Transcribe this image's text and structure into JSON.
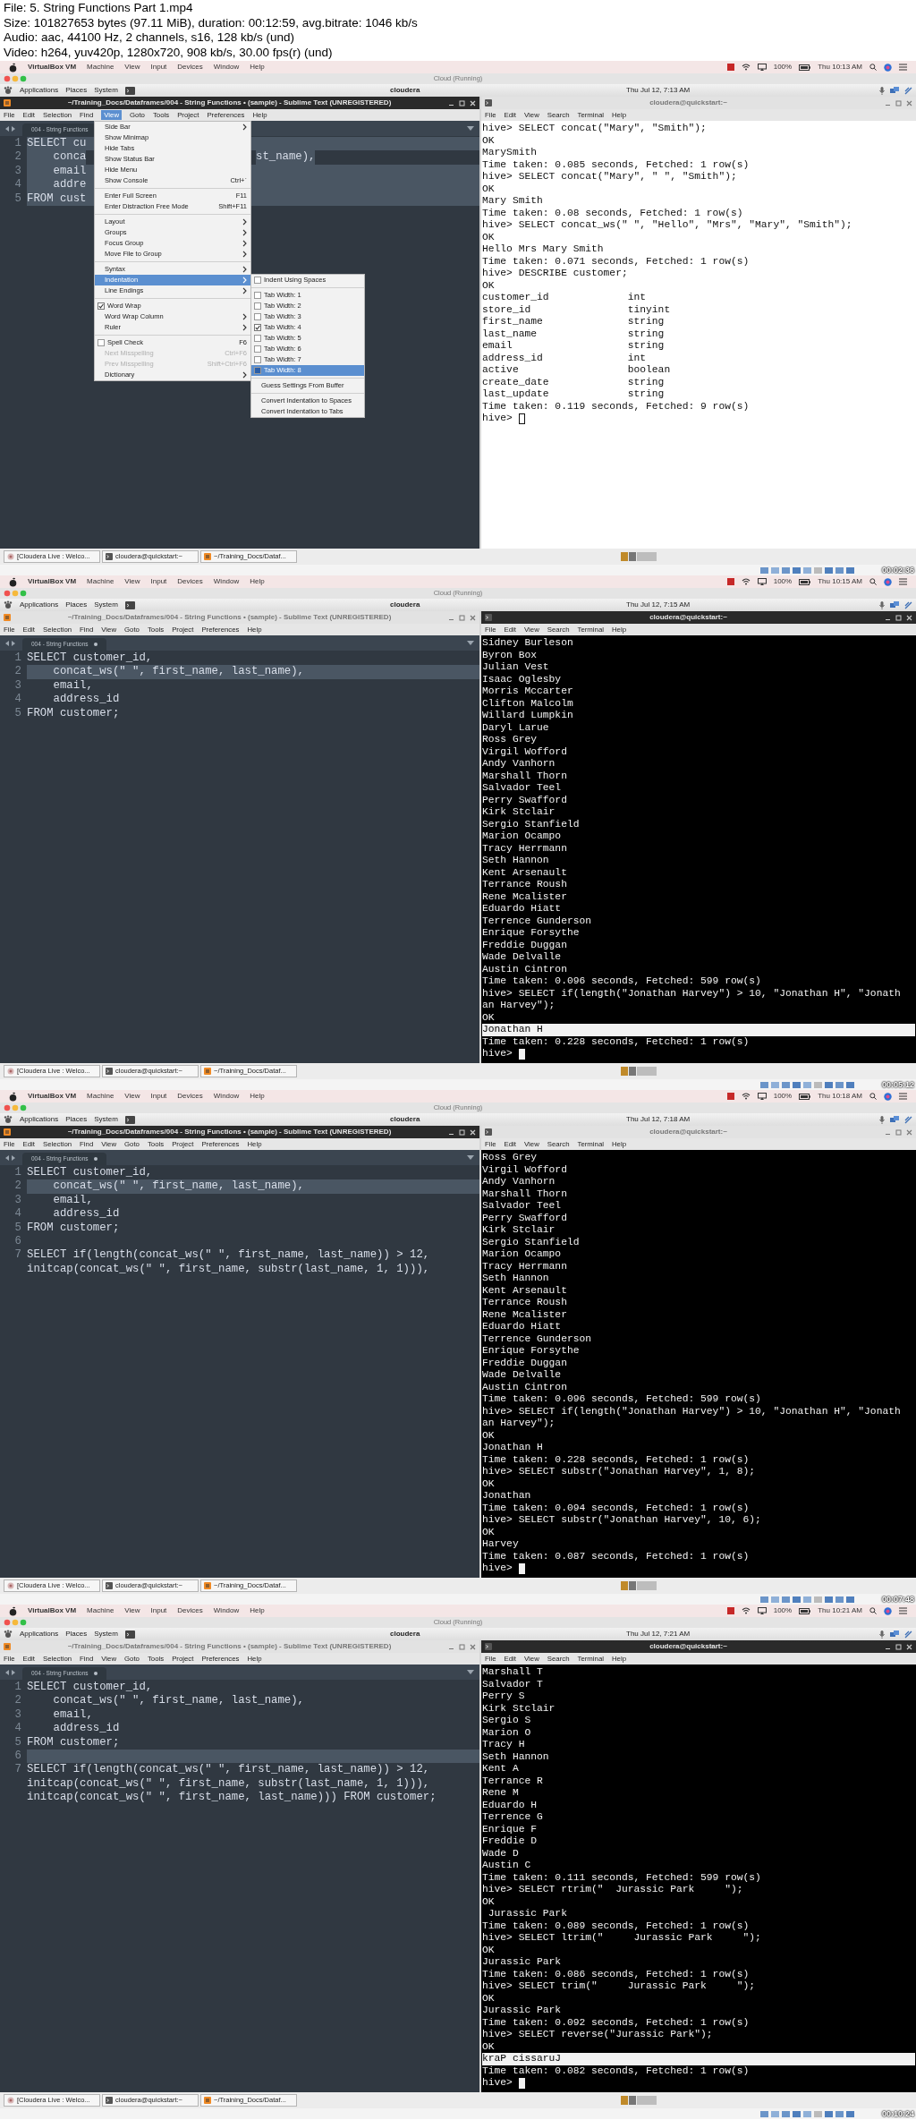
{
  "header": {
    "lines": [
      "File: 5. String Functions Part 1.mp4",
      "Size: 101827653 bytes (97.11 MiB), duration: 00:12:59, avg.bitrate: 1046 kb/s",
      "Audio: aac, 44100 Hz, 2 channels, s16, 128 kb/s (und)",
      "Video: h264, yuv420p, 1280x720, 908 kb/s, 30.00 fps(r) (und)"
    ]
  },
  "frames": [
    {
      "mac_menu": {
        "items": [
          "VirtualBox VM",
          "Machine",
          "View",
          "Input",
          "Devices",
          "Window",
          "Help"
        ],
        "battery": "100%",
        "clock": "Thu 10:13 AM"
      },
      "vm_window": {
        "title": "Cloud (Running)"
      },
      "guest_panel": {
        "menus": [
          "Applications",
          "Places",
          "System"
        ],
        "host": "cloudera",
        "clock": "Thu Jul 12, 7:13 AM"
      },
      "editor": {
        "title": "~/Training_Docs/Dataframes/004 - String Functions • (sample) - Sublime Text (UNREGISTERED)",
        "active": true,
        "menu": [
          {
            "label": "File",
            "selected": false
          },
          {
            "label": "Edit",
            "selected": false
          },
          {
            "label": "Selection",
            "selected": false
          },
          {
            "label": "Find",
            "selected": false
          },
          {
            "label": "View",
            "selected": true
          },
          {
            "label": "Goto",
            "selected": false
          },
          {
            "label": "Tools",
            "selected": false
          },
          {
            "label": "Project",
            "selected": false
          },
          {
            "label": "Preferences",
            "selected": false
          },
          {
            "label": "Help",
            "selected": false
          }
        ],
        "tab": "004 - String Functions",
        "lines": [
          {
            "num": "1",
            "text": "SELECT cu",
            "highlighted": true
          },
          {
            "num": "2",
            "text": "    conca",
            "tail": "st_name),",
            "highlighted": true
          },
          {
            "num": "3",
            "text": "    email",
            "highlighted": true
          },
          {
            "num": "4",
            "text": "    addre",
            "highlighted": true
          },
          {
            "num": "5",
            "text": "FROM cust",
            "highlighted": true
          }
        ],
        "popup": {
          "items": [
            {
              "kind": "submenu",
              "label": "Side Bar",
              "selected": false,
              "disabled": false
            },
            {
              "kind": "action",
              "label": "Show Minimap",
              "selected": false,
              "disabled": false
            },
            {
              "kind": "action",
              "label": "Hide Tabs",
              "selected": false,
              "disabled": false
            },
            {
              "kind": "action",
              "label": "Show Status Bar",
              "selected": false,
              "disabled": false
            },
            {
              "kind": "action",
              "label": "Hide Menu",
              "selected": false,
              "disabled": false
            },
            {
              "kind": "action",
              "label": "Show Console",
              "shortcut": "Ctrl+`",
              "selected": false,
              "disabled": false
            },
            {
              "kind": "separator"
            },
            {
              "kind": "action",
              "label": "Enter Full Screen",
              "shortcut": "F11",
              "selected": false,
              "disabled": false
            },
            {
              "kind": "action",
              "label": "Enter Distraction Free Mode",
              "shortcut": "Shift+F11",
              "selected": false,
              "disabled": false
            },
            {
              "kind": "separator"
            },
            {
              "kind": "submenu",
              "label": "Layout",
              "selected": false,
              "disabled": false
            },
            {
              "kind": "submenu",
              "label": "Groups",
              "selected": false,
              "disabled": false
            },
            {
              "kind": "submenu",
              "label": "Focus Group",
              "selected": false,
              "disabled": false
            },
            {
              "kind": "submenu",
              "label": "Move File to Group",
              "selected": false,
              "disabled": false
            },
            {
              "kind": "separator"
            },
            {
              "kind": "submenu",
              "label": "Syntax",
              "selected": false,
              "disabled": false
            },
            {
              "kind": "submenu",
              "label": "Indentation",
              "selected": true,
              "disabled": false,
              "items": [
                {
                  "kind": "check",
                  "label": "Indent Using Spaces",
                  "checked": false,
                  "selected": false,
                  "disabled": false
                },
                {
                  "kind": "separator"
                },
                {
                  "kind": "check",
                  "label": "Tab Width: 1",
                  "checked": false,
                  "selected": false,
                  "disabled": false
                },
                {
                  "kind": "check",
                  "label": "Tab Width: 2",
                  "checked": false,
                  "selected": false,
                  "disabled": false
                },
                {
                  "kind": "check",
                  "label": "Tab Width: 3",
                  "checked": false,
                  "selected": false,
                  "disabled": false
                },
                {
                  "kind": "check",
                  "label": "Tab Width: 4",
                  "checked": true,
                  "selected": false,
                  "disabled": false
                },
                {
                  "kind": "check",
                  "label": "Tab Width: 5",
                  "checked": false,
                  "selected": false,
                  "disabled": false
                },
                {
                  "kind": "check",
                  "label": "Tab Width: 6",
                  "checked": false,
                  "selected": false,
                  "disabled": false
                },
                {
                  "kind": "check",
                  "label": "Tab Width: 7",
                  "checked": false,
                  "selected": false,
                  "disabled": false
                },
                {
                  "kind": "check",
                  "label": "Tab Width: 8",
                  "checked": false,
                  "selected": true,
                  "disabled": false
                },
                {
                  "kind": "separator"
                },
                {
                  "kind": "action",
                  "label": "Guess Settings From Buffer",
                  "selected": false,
                  "disabled": false
                },
                {
                  "kind": "separator"
                },
                {
                  "kind": "action",
                  "label": "Convert Indentation to Spaces",
                  "selected": false,
                  "disabled": false
                },
                {
                  "kind": "action",
                  "label": "Convert Indentation to Tabs",
                  "selected": false,
                  "disabled": false
                }
              ]
            },
            {
              "kind": "submenu",
              "label": "Line Endings",
              "selected": false,
              "disabled": false
            },
            {
              "kind": "separator"
            },
            {
              "kind": "check",
              "label": "Word Wrap",
              "checked": true,
              "selected": false,
              "disabled": false
            },
            {
              "kind": "submenu",
              "label": "Word Wrap Column",
              "selected": false,
              "disabled": false
            },
            {
              "kind": "submenu",
              "label": "Ruler",
              "selected": false,
              "disabled": false
            },
            {
              "kind": "separator"
            },
            {
              "kind": "check",
              "label": "Spell Check",
              "shortcut": "F6",
              "checked": false,
              "selected": false,
              "disabled": false
            },
            {
              "kind": "action",
              "label": "Next Misspelling",
              "shortcut": "Ctrl+F6",
              "selected": false,
              "disabled": true
            },
            {
              "kind": "action",
              "label": "Prev Misspelling",
              "shortcut": "Shift+Ctrl+F6",
              "selected": false,
              "disabled": true
            },
            {
              "kind": "submenu",
              "label": "Dictionary",
              "selected": false,
              "disabled": false
            }
          ]
        }
      },
      "terminal": {
        "title": "cloudera@quickstart:~",
        "active": false,
        "dark": false,
        "cursor": true,
        "menu": [
          "File",
          "Edit",
          "View",
          "Search",
          "Terminal",
          "Help"
        ],
        "lines": [
          {
            "text": "hive> SELECT concat(\"Mary\", \"Smith\");",
            "highlighted": false
          },
          {
            "text": "OK",
            "highlighted": false
          },
          {
            "text": "MarySmith",
            "highlighted": false
          },
          {
            "text": "Time taken: 0.085 seconds, Fetched: 1 row(s)",
            "highlighted": false
          },
          {
            "text": "hive> SELECT concat(\"Mary\", \" \", \"Smith\");",
            "highlighted": false
          },
          {
            "text": "OK",
            "highlighted": false
          },
          {
            "text": "Mary Smith",
            "highlighted": false
          },
          {
            "text": "Time taken: 0.08 seconds, Fetched: 1 row(s)",
            "highlighted": false
          },
          {
            "text": "hive> SELECT concat_ws(\" \", \"Hello\", \"Mrs\", \"Mary\", \"Smith\");",
            "highlighted": false
          },
          {
            "text": "OK",
            "highlighted": false
          },
          {
            "text": "Hello Mrs Mary Smith",
            "highlighted": false
          },
          {
            "text": "Time taken: 0.071 seconds, Fetched: 1 row(s)",
            "highlighted": false
          },
          {
            "text": "hive> DESCRIBE customer;",
            "highlighted": false
          },
          {
            "text": "OK",
            "highlighted": false
          },
          {
            "text": "customer_id             int",
            "highlighted": false
          },
          {
            "text": "store_id                tinyint",
            "highlighted": false
          },
          {
            "text": "first_name              string",
            "highlighted": false
          },
          {
            "text": "last_name               string",
            "highlighted": false
          },
          {
            "text": "email                   string",
            "highlighted": false
          },
          {
            "text": "address_id              int",
            "highlighted": false
          },
          {
            "text": "active                  boolean",
            "highlighted": false
          },
          {
            "text": "create_date             string",
            "highlighted": false
          },
          {
            "text": "last_update             string",
            "highlighted": false
          },
          {
            "text": "Time taken: 0.119 seconds, Fetched: 9 row(s)",
            "highlighted": false
          },
          {
            "text": "hive>",
            "highlighted": false
          }
        ]
      },
      "taskbar": {
        "tasks": [
          {
            "label": "[Cloudera Live : Welco...",
            "kind": "browser"
          },
          {
            "label": "cloudera@quickstart:~",
            "kind": "terminal"
          },
          {
            "label": "~/Training_Docs/Dataf...",
            "kind": "editor"
          }
        ]
      },
      "timestamp": "00:02:36"
    },
    {
      "mac_menu": {
        "items": [
          "VirtualBox VM",
          "Machine",
          "View",
          "Input",
          "Devices",
          "Window",
          "Help"
        ],
        "battery": "100%",
        "clock": "Thu 10:15 AM"
      },
      "vm_window": {
        "title": "Cloud (Running)"
      },
      "guest_panel": {
        "menus": [
          "Applications",
          "Places",
          "System"
        ],
        "host": "cloudera",
        "clock": "Thu Jul 12, 7:15 AM"
      },
      "editor": {
        "title": "~/Training_Docs/Dataframes/004 - String Functions • (sample) - Sublime Text (UNREGISTERED)",
        "active": false,
        "menu": [
          {
            "label": "File",
            "selected": false
          },
          {
            "label": "Edit",
            "selected": false
          },
          {
            "label": "Selection",
            "selected": false
          },
          {
            "label": "Find",
            "selected": false
          },
          {
            "label": "View",
            "selected": false
          },
          {
            "label": "Goto",
            "selected": false
          },
          {
            "label": "Tools",
            "selected": false
          },
          {
            "label": "Project",
            "selected": false
          },
          {
            "label": "Preferences",
            "selected": false
          },
          {
            "label": "Help",
            "selected": false
          }
        ],
        "tab": "004 - String Functions",
        "lines": [
          {
            "num": "1",
            "text": "SELECT customer_id,",
            "highlighted": false
          },
          {
            "num": "2",
            "text": "    concat_ws(\" \", first_name, last_name),",
            "highlighted": true
          },
          {
            "num": "3",
            "text": "    email,",
            "highlighted": false
          },
          {
            "num": "4",
            "text": "    address_id",
            "highlighted": false
          },
          {
            "num": "5",
            "text": "FROM customer;",
            "highlighted": false
          }
        ]
      },
      "terminal": {
        "title": "cloudera@quickstart:~",
        "active": true,
        "dark": true,
        "cursor": true,
        "menu": [
          "File",
          "Edit",
          "View",
          "Search",
          "Terminal",
          "Help"
        ],
        "lines": [
          {
            "text": "Sidney Burleson",
            "highlighted": false
          },
          {
            "text": "Byron Box",
            "highlighted": false
          },
          {
            "text": "Julian Vest",
            "highlighted": false
          },
          {
            "text": "Isaac Oglesby",
            "highlighted": false
          },
          {
            "text": "Morris Mccarter",
            "highlighted": false
          },
          {
            "text": "Clifton Malcolm",
            "highlighted": false
          },
          {
            "text": "Willard Lumpkin",
            "highlighted": false
          },
          {
            "text": "Daryl Larue",
            "highlighted": false
          },
          {
            "text": "Ross Grey",
            "highlighted": false
          },
          {
            "text": "Virgil Wofford",
            "highlighted": false
          },
          {
            "text": "Andy Vanhorn",
            "highlighted": false
          },
          {
            "text": "Marshall Thorn",
            "highlighted": false
          },
          {
            "text": "Salvador Teel",
            "highlighted": false
          },
          {
            "text": "Perry Swafford",
            "highlighted": false
          },
          {
            "text": "Kirk Stclair",
            "highlighted": false
          },
          {
            "text": "Sergio Stanfield",
            "highlighted": false
          },
          {
            "text": "Marion Ocampo",
            "highlighted": false
          },
          {
            "text": "Tracy Herrmann",
            "highlighted": false
          },
          {
            "text": "Seth Hannon",
            "highlighted": false
          },
          {
            "text": "Kent Arsenault",
            "highlighted": false
          },
          {
            "text": "Terrance Roush",
            "highlighted": false
          },
          {
            "text": "Rene Mcalister",
            "highlighted": false
          },
          {
            "text": "Eduardo Hiatt",
            "highlighted": false
          },
          {
            "text": "Terrence Gunderson",
            "highlighted": false
          },
          {
            "text": "Enrique Forsythe",
            "highlighted": false
          },
          {
            "text": "Freddie Duggan",
            "highlighted": false
          },
          {
            "text": "Wade Delvalle",
            "highlighted": false
          },
          {
            "text": "Austin Cintron",
            "highlighted": false
          },
          {
            "text": "Time taken: 0.096 seconds, Fetched: 599 row(s)",
            "highlighted": false
          },
          {
            "text": "hive> SELECT if(length(\"Jonathan Harvey\") > 10, \"Jonathan H\", \"Jonath",
            "highlighted": false
          },
          {
            "text": "an Harvey\");",
            "highlighted": false
          },
          {
            "text": "OK",
            "highlighted": false
          },
          {
            "text": "Jonathan H",
            "highlighted": true
          },
          {
            "text": "Time taken: 0.228 seconds, Fetched: 1 row(s)",
            "highlighted": false
          },
          {
            "text": "hive>",
            "highlighted": false
          }
        ]
      },
      "taskbar": {
        "tasks": [
          {
            "label": "[Cloudera Live : Welco...",
            "kind": "browser"
          },
          {
            "label": "cloudera@quickstart:~",
            "kind": "terminal"
          },
          {
            "label": "~/Training_Docs/Dataf...",
            "kind": "editor"
          }
        ]
      },
      "timestamp": "00:05:12"
    },
    {
      "mac_menu": {
        "items": [
          "VirtualBox VM",
          "Machine",
          "View",
          "Input",
          "Devices",
          "Window",
          "Help"
        ],
        "battery": "100%",
        "clock": "Thu 10:18 AM"
      },
      "vm_window": {
        "title": "Cloud (Running)"
      },
      "guest_panel": {
        "menus": [
          "Applications",
          "Places",
          "System"
        ],
        "host": "cloudera",
        "clock": "Thu Jul 12, 7:18 AM"
      },
      "editor": {
        "title": "~/Training_Docs/Dataframes/004 - String Functions • (sample) - Sublime Text (UNREGISTERED)",
        "active": true,
        "menu": [
          {
            "label": "File",
            "selected": false
          },
          {
            "label": "Edit",
            "selected": false
          },
          {
            "label": "Selection",
            "selected": false
          },
          {
            "label": "Find",
            "selected": false
          },
          {
            "label": "View",
            "selected": false
          },
          {
            "label": "Goto",
            "selected": false
          },
          {
            "label": "Tools",
            "selected": false
          },
          {
            "label": "Project",
            "selected": false
          },
          {
            "label": "Preferences",
            "selected": false
          },
          {
            "label": "Help",
            "selected": false
          }
        ],
        "tab": "004 - String Functions",
        "lines": [
          {
            "num": "1",
            "text": "SELECT customer_id,",
            "highlighted": false
          },
          {
            "num": "2",
            "text": "    concat_ws(\" \", first_name, last_name),",
            "highlighted": true
          },
          {
            "num": "3",
            "text": "    email,",
            "highlighted": false
          },
          {
            "num": "4",
            "text": "    address_id",
            "highlighted": false
          },
          {
            "num": "5",
            "text": "FROM customer;",
            "highlighted": false
          },
          {
            "num": "6",
            "highlighted": false
          },
          {
            "num": "7",
            "text": "SELECT if(length(concat_ws(\" \", first_name, last_name)) > 12,",
            "highlighted": false
          },
          {
            "text": "initcap(concat_ws(\" \", first_name, substr(last_name, 1, 1))),",
            "highlighted": false
          }
        ]
      },
      "terminal": {
        "title": "cloudera@quickstart:~",
        "active": false,
        "dark": true,
        "cursor": true,
        "menu": [
          "File",
          "Edit",
          "View",
          "Search",
          "Terminal",
          "Help"
        ],
        "lines": [
          {
            "text": "Ross Grey",
            "highlighted": false
          },
          {
            "text": "Virgil Wofford",
            "highlighted": false
          },
          {
            "text": "Andy Vanhorn",
            "highlighted": false
          },
          {
            "text": "Marshall Thorn",
            "highlighted": false
          },
          {
            "text": "Salvador Teel",
            "highlighted": false
          },
          {
            "text": "Perry Swafford",
            "highlighted": false
          },
          {
            "text": "Kirk Stclair",
            "highlighted": false
          },
          {
            "text": "Sergio Stanfield",
            "highlighted": false
          },
          {
            "text": "Marion Ocampo",
            "highlighted": false
          },
          {
            "text": "Tracy Herrmann",
            "highlighted": false
          },
          {
            "text": "Seth Hannon",
            "highlighted": false
          },
          {
            "text": "Kent Arsenault",
            "highlighted": false
          },
          {
            "text": "Terrance Roush",
            "highlighted": false
          },
          {
            "text": "Rene Mcalister",
            "highlighted": false
          },
          {
            "text": "Eduardo Hiatt",
            "highlighted": false
          },
          {
            "text": "Terrence Gunderson",
            "highlighted": false
          },
          {
            "text": "Enrique Forsythe",
            "highlighted": false
          },
          {
            "text": "Freddie Duggan",
            "highlighted": false
          },
          {
            "text": "Wade Delvalle",
            "highlighted": false
          },
          {
            "text": "Austin Cintron",
            "highlighted": false
          },
          {
            "text": "Time taken: 0.096 seconds, Fetched: 599 row(s)",
            "highlighted": false
          },
          {
            "text": "hive> SELECT if(length(\"Jonathan Harvey\") > 10, \"Jonathan H\", \"Jonath",
            "highlighted": false
          },
          {
            "text": "an Harvey\");",
            "highlighted": false
          },
          {
            "text": "OK",
            "highlighted": false
          },
          {
            "text": "Jonathan H",
            "highlighted": false
          },
          {
            "text": "Time taken: 0.228 seconds, Fetched: 1 row(s)",
            "highlighted": false
          },
          {
            "text": "hive> SELECT substr(\"Jonathan Harvey\", 1, 8);",
            "highlighted": false
          },
          {
            "text": "OK",
            "highlighted": false
          },
          {
            "text": "Jonathan",
            "highlighted": false
          },
          {
            "text": "Time taken: 0.094 seconds, Fetched: 1 row(s)",
            "highlighted": false
          },
          {
            "text": "hive> SELECT substr(\"Jonathan Harvey\", 10, 6);",
            "highlighted": false
          },
          {
            "text": "OK",
            "highlighted": false
          },
          {
            "text": "Harvey",
            "highlighted": false
          },
          {
            "text": "Time taken: 0.087 seconds, Fetched: 1 row(s)",
            "highlighted": false
          },
          {
            "text": "hive>",
            "highlighted": false
          }
        ]
      },
      "taskbar": {
        "tasks": [
          {
            "label": "[Cloudera Live : Welco...",
            "kind": "browser"
          },
          {
            "label": "cloudera@quickstart:~",
            "kind": "terminal"
          },
          {
            "label": "~/Training_Docs/Dataf...",
            "kind": "editor"
          }
        ]
      },
      "timestamp": "00:07:48"
    },
    {
      "mac_menu": {
        "items": [
          "VirtualBox VM",
          "Machine",
          "View",
          "Input",
          "Devices",
          "Window",
          "Help"
        ],
        "battery": "100%",
        "clock": "Thu 10:21 AM"
      },
      "vm_window": {
        "title": "Cloud (Running)"
      },
      "guest_panel": {
        "menus": [
          "Applications",
          "Places",
          "System"
        ],
        "host": "cloudera",
        "clock": "Thu Jul 12, 7:21 AM"
      },
      "editor": {
        "title": "~/Training_Docs/Dataframes/004 - String Functions • (sample) - Sublime Text (UNREGISTERED)",
        "active": false,
        "menu": [
          {
            "label": "File",
            "selected": false
          },
          {
            "label": "Edit",
            "selected": false
          },
          {
            "label": "Selection",
            "selected": false
          },
          {
            "label": "Find",
            "selected": false
          },
          {
            "label": "View",
            "selected": false
          },
          {
            "label": "Goto",
            "selected": false
          },
          {
            "label": "Tools",
            "selected": false
          },
          {
            "label": "Project",
            "selected": false
          },
          {
            "label": "Preferences",
            "selected": false
          },
          {
            "label": "Help",
            "selected": false
          }
        ],
        "tab": "004 - String Functions",
        "lines": [
          {
            "num": "1",
            "text": "SELECT customer_id,",
            "highlighted": false
          },
          {
            "num": "2",
            "text": "    concat_ws(\" \", first_name, last_name),",
            "highlighted": false
          },
          {
            "num": "3",
            "text": "    email,",
            "highlighted": false
          },
          {
            "num": "4",
            "text": "    address_id",
            "highlighted": false
          },
          {
            "num": "5",
            "text": "FROM customer;",
            "highlighted": false
          },
          {
            "num": "6",
            "highlighted": true
          },
          {
            "num": "7",
            "text": "SELECT if(length(concat_ws(\" \", first_name, last_name)) > 12,",
            "highlighted": false
          },
          {
            "text": "initcap(concat_ws(\" \", first_name, substr(last_name, 1, 1))),",
            "highlighted": false
          },
          {
            "text": "initcap(concat_ws(\" \", first_name, last_name))) FROM customer;",
            "highlighted": false
          }
        ]
      },
      "terminal": {
        "title": "cloudera@quickstart:~",
        "active": true,
        "dark": true,
        "cursor": true,
        "menu": [
          "File",
          "Edit",
          "View",
          "Search",
          "Terminal",
          "Help"
        ],
        "lines": [
          {
            "text": "Marshall T",
            "highlighted": false
          },
          {
            "text": "Salvador T",
            "highlighted": false
          },
          {
            "text": "Perry S",
            "highlighted": false
          },
          {
            "text": "Kirk Stclair",
            "highlighted": false
          },
          {
            "text": "Sergio S",
            "highlighted": false
          },
          {
            "text": "Marion O",
            "highlighted": false
          },
          {
            "text": "Tracy H",
            "highlighted": false
          },
          {
            "text": "Seth Hannon",
            "highlighted": false
          },
          {
            "text": "Kent A",
            "highlighted": false
          },
          {
            "text": "Terrance R",
            "highlighted": false
          },
          {
            "text": "Rene M",
            "highlighted": false
          },
          {
            "text": "Eduardo H",
            "highlighted": false
          },
          {
            "text": "Terrence G",
            "highlighted": false
          },
          {
            "text": "Enrique F",
            "highlighted": false
          },
          {
            "text": "Freddie D",
            "highlighted": false
          },
          {
            "text": "Wade D",
            "highlighted": false
          },
          {
            "text": "Austin C",
            "highlighted": false
          },
          {
            "text": "Time taken: 0.111 seconds, Fetched: 599 row(s)",
            "highlighted": false
          },
          {
            "text": "hive> SELECT rtrim(\"  Jurassic Park     \");",
            "highlighted": false
          },
          {
            "text": "OK",
            "highlighted": false
          },
          {
            "text": " Jurassic Park",
            "highlighted": false
          },
          {
            "text": "Time taken: 0.089 seconds, Fetched: 1 row(s)",
            "highlighted": false
          },
          {
            "text": "hive> SELECT ltrim(\"     Jurassic Park     \");",
            "highlighted": false
          },
          {
            "text": "OK",
            "highlighted": false
          },
          {
            "text": "Jurassic Park",
            "highlighted": false
          },
          {
            "text": "Time taken: 0.086 seconds, Fetched: 1 row(s)",
            "highlighted": false
          },
          {
            "text": "hive> SELECT trim(\"     Jurassic Park     \");",
            "highlighted": false
          },
          {
            "text": "OK",
            "highlighted": false
          },
          {
            "text": "Jurassic Park",
            "highlighted": false
          },
          {
            "text": "Time taken: 0.092 seconds, Fetched: 1 row(s)",
            "highlighted": false
          },
          {
            "text": "hive> SELECT reverse(\"Jurassic Park\");",
            "highlighted": false
          },
          {
            "text": "OK",
            "highlighted": false
          },
          {
            "text": "kraP cissaruJ",
            "highlighted": true
          },
          {
            "text": "Time taken: 0.082 seconds, Fetched: 1 row(s)",
            "highlighted": false
          },
          {
            "text": "hive>",
            "highlighted": false
          }
        ]
      },
      "taskbar": {
        "tasks": [
          {
            "label": "[Cloudera Live : Welco...",
            "kind": "browser"
          },
          {
            "label": "cloudera@quickstart:~",
            "kind": "terminal"
          },
          {
            "label": "~/Training_Docs/Dataf...",
            "kind": "editor"
          }
        ]
      },
      "timestamp": "00:10:24"
    }
  ]
}
